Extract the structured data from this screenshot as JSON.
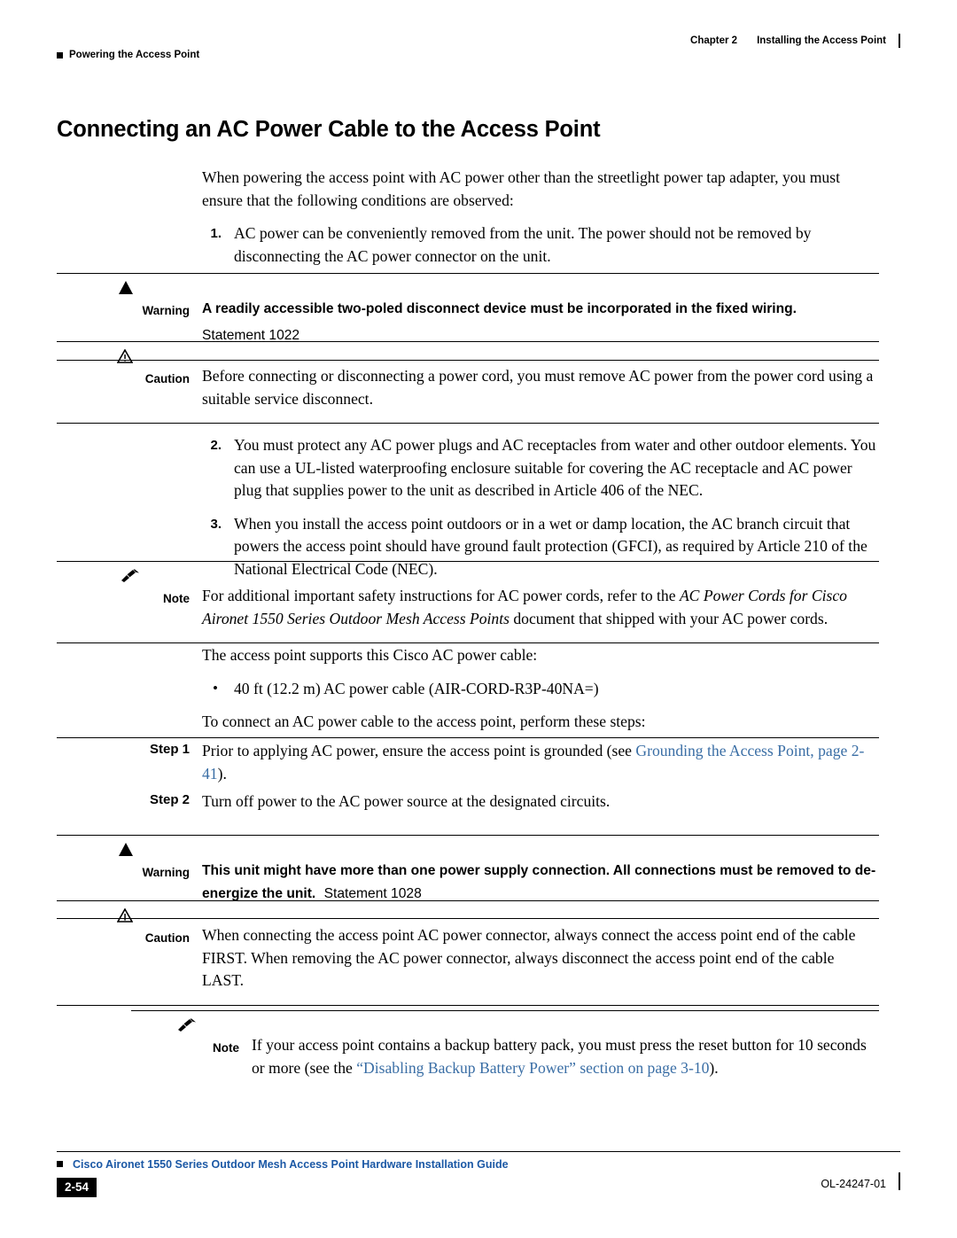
{
  "header": {
    "left_label": "Powering the Access Point",
    "chapter": "Chapter 2",
    "chapter_title": "Installing the Access Point"
  },
  "title": "Connecting an AC Power Cable to the Access Point",
  "intro": "When powering the access point with AC power other than the streetlight power tap adapter, you must ensure that the following conditions are observed:",
  "list1": {
    "num": "1.",
    "text": "AC power can be conveniently removed from the unit. The power should not be removed by disconnecting the AC power connector on the unit."
  },
  "warning1": {
    "label": "Warning",
    "icon": "warning-triangle-icon",
    "text": "A readily accessible two-poled disconnect device must be incorporated in the fixed wiring.",
    "statement": "Statement 1022"
  },
  "caution1": {
    "label": "Caution",
    "icon": "caution-triangle-icon",
    "text": "Before connecting or disconnecting a power cord, you must remove AC power from the power cord using a suitable service disconnect."
  },
  "list2": {
    "num": "2.",
    "text": "You must protect any AC power plugs and AC receptacles from water and other outdoor elements. You can use a UL-listed waterproofing enclosure suitable for covering the AC receptacle and AC power plug that supplies power to the unit as described in Article 406 of the NEC."
  },
  "list3": {
    "num": "3.",
    "text": "When you install the access point outdoors or in a wet or damp location, the AC branch circuit that powers the access point should have ground fault protection (GFCI), as required by Article 210 of the National Electrical Code (NEC)."
  },
  "note1": {
    "label": "Note",
    "icon": "note-pencil-icon",
    "text_part1": "For additional important safety instructions for AC power cords, refer to the ",
    "italic1": "AC Power Cords for Cisco Aironet 1550 Series Outdoor Mesh Access Points",
    "text_part2": " document that shipped with your AC power cords."
  },
  "supports_line": "The access point supports this Cisco AC power cable:",
  "cable_bullet": "40 ft (12.2 m) AC power cable (AIR-CORD-R3P-40NA=)",
  "connect_line": "To connect an AC power cable to the access point, perform these steps:",
  "step1": {
    "label": "Step 1",
    "text_part1": "Prior to applying AC power, ensure the access point is grounded (see ",
    "link": "Grounding the Access Point, page 2-41",
    "text_part2": ")."
  },
  "step2": {
    "label": "Step 2",
    "text": "Turn off power to the AC power source at the designated circuits."
  },
  "warning2": {
    "label": "Warning",
    "icon": "warning-triangle-icon",
    "text": "This unit might have more than one power supply connection. All connections must be removed to de-energize the unit.",
    "statement": "Statement 1028"
  },
  "caution2": {
    "label": "Caution",
    "icon": "caution-triangle-icon",
    "text": "When connecting the access point AC power connector, always connect the access point end of the cable FIRST. When removing the AC power connector, always disconnect the access point end of the cable LAST."
  },
  "note2": {
    "label": "Note",
    "icon": "note-pencil-icon",
    "text_part1": "If your access point contains a backup battery pack, you must press the reset button for 10 seconds or more (see the ",
    "link": "“Disabling Backup Battery Power” section on page 3-10",
    "text_part2": ")."
  },
  "footer": {
    "guide": "Cisco Aironet 1550 Series Outdoor Mesh Access Point Hardware Installation Guide",
    "page": "2-54",
    "docnum": "OL-24247-01"
  },
  "colors": {
    "link": "#3a6ea5",
    "footer_guide": "#1b58a5"
  }
}
